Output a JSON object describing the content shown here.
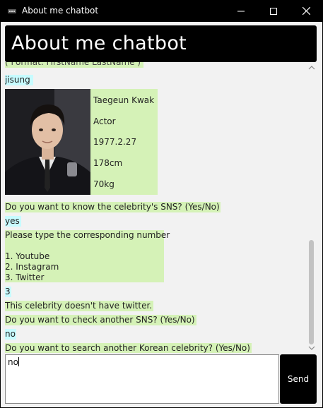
{
  "window": {
    "title": "About me chatbot"
  },
  "header": {
    "title": "About me chatbot"
  },
  "chat": {
    "clipped_hint": "( Format: FirstName LastName )",
    "m1_user": "jisung",
    "profile": {
      "name": "Taegeun Kwak",
      "job": "Actor",
      "birth": "1977.2.27",
      "height": "178cm",
      "weight": "70kg"
    },
    "m2_bot": "Do you want to know the celebrity's SNS? (Yes/No)",
    "m3_user": "yes",
    "m4_bot_lines": [
      "Please type the corresponding number",
      "1. Youtube",
      "2. Instagram",
      "3. Twitter"
    ],
    "m5_user": "3",
    "m6_bot": "This celebrity doesn't have twitter.",
    "m7_bot": "Do you want to check another SNS? (Yes/No)",
    "m8_user": "no",
    "m9_bot": "Do you want to search another Korean celebrity? (Yes/No)"
  },
  "input": {
    "value": "no"
  },
  "send": {
    "label": "Send"
  },
  "colors": {
    "bot_bubble": "#d5f2b7",
    "user_bubble": "#c7fbff",
    "header_bg": "#000000"
  },
  "scroll": {
    "position": 0.95
  }
}
